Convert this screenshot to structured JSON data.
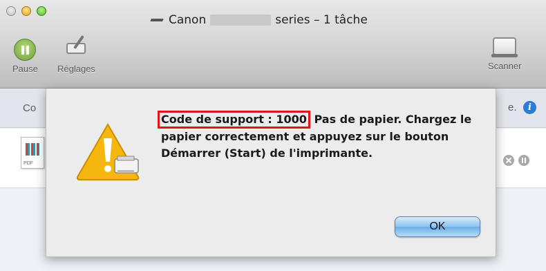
{
  "window": {
    "title_prefix": "Canon",
    "title_suffix": "series – 1 tâche"
  },
  "toolbar": {
    "pause_label": "Pause",
    "settings_label": "Réglages",
    "scanner_label": "Scanner"
  },
  "infobar": {
    "text_left": "Co",
    "text_right": "e."
  },
  "job": {
    "file_type_label": "PDF"
  },
  "alert": {
    "code": "Code de support : 1000",
    "message_first_line": "Pas de papier.",
    "message_rest": "Chargez le papier correctement et appuyez sur le bouton Démarrer (Start) de l'imprimante.",
    "ok_label": "OK"
  },
  "colors": {
    "highlight_box": "#e0141a",
    "warning_yellow": "#f5b60d",
    "ok_button": "#69aee8",
    "info_icon": "#2c7bd4"
  }
}
